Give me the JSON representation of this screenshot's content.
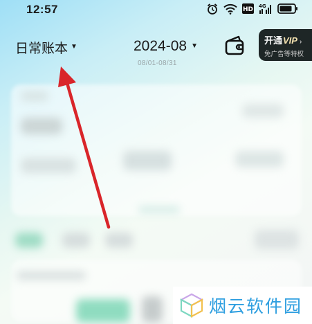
{
  "status_bar": {
    "time": "12:57",
    "icons": [
      "alarm-icon",
      "wifi-icon",
      "hd-icon",
      "signal-4g-icon",
      "battery-icon"
    ],
    "hd_label": "HD",
    "network_label": "4G"
  },
  "header": {
    "book_name": "日常账本",
    "month": "2024-08",
    "month_range": "08/01-08/31",
    "wallet_icon": "wallet-icon",
    "vip": {
      "title_prefix": "开通",
      "title_vip": "VIP",
      "subtitle": "免广告等特权"
    }
  },
  "annotation": {
    "arrow_color": "#d9252a"
  },
  "watermark": {
    "text": "烟云软件园"
  },
  "colors": {
    "accent_green": "#6fd3b3",
    "vip_bg": "#1e2626",
    "arrow": "#d9252a",
    "watermark": "#2f9fe0"
  }
}
